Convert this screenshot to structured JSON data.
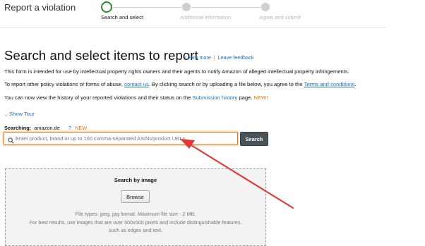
{
  "header": {
    "title": "Report a violation"
  },
  "stepper": {
    "steps": [
      {
        "label": "Search and select",
        "state": "active"
      },
      {
        "label": "Additional information",
        "state": "inactive"
      },
      {
        "label": "Agree and submit",
        "state": "inactive"
      }
    ]
  },
  "main": {
    "heading": "Search and select items to report",
    "learn_more": "Learn more",
    "separator": "|",
    "leave_feedback": "Leave feedback",
    "intro_text": "This form is intended for use by intellectual property rights owners and their agents to notify Amazon of alleged intellectual property infringements.",
    "other_text_prefix": "To report other policy violations or forms of abuse,",
    "contact_us": "contact us",
    "other_text_mid": ". By clicking search or by uploading a file below, you agree to the",
    "terms_link": "Terms and conditions",
    "other_text_suffix": ".",
    "history_prefix": "You can now view the history of your reported violations and their status on the",
    "history_link": "Submission history",
    "history_suffix": "page.",
    "new_badge": "NEW!",
    "show_tour": "Show Tour"
  },
  "search": {
    "searching_label": "Searching:",
    "marketplace": "amazon.de",
    "help": "?",
    "new_badge": "NEW",
    "placeholder": "Enter product, brand or up to 100 comma-separated ASINs/product URLs",
    "button_label": "Search"
  },
  "image_search": {
    "title": "Search by image",
    "browse_label": "Browse",
    "file_types": "File types: jpeg, jpg format. Maximum file size - 2 MB.",
    "tip_line1": "For best results, use images that are over 500x500 pixels and include distinguishable features,",
    "tip_line2": "such as edges and text."
  },
  "colors": {
    "accent_orange": "#e77600",
    "link_blue": "#1a6fb5",
    "step_green": "#2d8c2d",
    "annotation_red": "#e53935",
    "search_button": "#4a5358"
  },
  "icons": [
    "search-icon",
    "chevron-down-icon",
    "annotation-arrow"
  ]
}
